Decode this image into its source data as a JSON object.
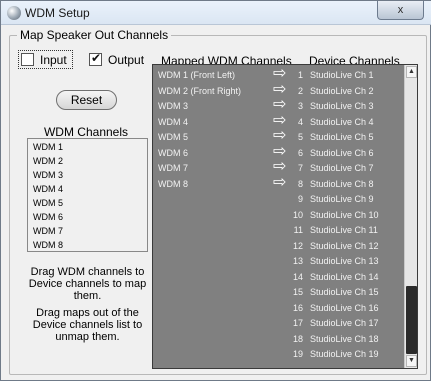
{
  "window": {
    "title": "WDM Setup",
    "close_glyph": "x"
  },
  "group": {
    "title": "Map Speaker Out Channels"
  },
  "checkboxes": {
    "input": {
      "label": "Input",
      "checked": false
    },
    "output": {
      "label": "Output",
      "checked": true
    }
  },
  "reset_label": "Reset",
  "wdm_channels": {
    "heading": "WDM Channels",
    "items": [
      "WDM 1",
      "WDM 2",
      "WDM 3",
      "WDM 4",
      "WDM 5",
      "WDM 6",
      "WDM 7",
      "WDM 8"
    ]
  },
  "help": {
    "drag_to_map": "Drag WDM channels to Device channels to map them.",
    "drag_to_unmap": "Drag maps out of the Device channels list to unmap them."
  },
  "headers": {
    "mapped": "Mapped WDM Channels",
    "device": "Device Channels"
  },
  "arrow_glyph": "⇨",
  "rows": [
    {
      "wdm": "WDM 1 (Front Left)",
      "num": "1",
      "device": "StudioLive Ch 1",
      "mapped": true
    },
    {
      "wdm": "WDM 2 (Front Right)",
      "num": "2",
      "device": "StudioLive Ch 2",
      "mapped": true
    },
    {
      "wdm": "WDM 3",
      "num": "3",
      "device": "StudioLive Ch 3",
      "mapped": true
    },
    {
      "wdm": "WDM 4",
      "num": "4",
      "device": "StudioLive Ch 4",
      "mapped": true
    },
    {
      "wdm": "WDM 5",
      "num": "5",
      "device": "StudioLive Ch 5",
      "mapped": true
    },
    {
      "wdm": "WDM 6",
      "num": "6",
      "device": "StudioLive Ch 6",
      "mapped": true
    },
    {
      "wdm": "WDM 7",
      "num": "7",
      "device": "StudioLive Ch 7",
      "mapped": true
    },
    {
      "wdm": "WDM 8",
      "num": "8",
      "device": "StudioLive Ch 8",
      "mapped": true
    },
    {
      "wdm": "",
      "num": "9",
      "device": "StudioLive Ch 9",
      "mapped": false
    },
    {
      "wdm": "",
      "num": "10",
      "device": "StudioLive Ch 10",
      "mapped": false
    },
    {
      "wdm": "",
      "num": "11",
      "device": "StudioLive Ch 11",
      "mapped": false
    },
    {
      "wdm": "",
      "num": "12",
      "device": "StudioLive Ch 12",
      "mapped": false
    },
    {
      "wdm": "",
      "num": "13",
      "device": "StudioLive Ch 13",
      "mapped": false
    },
    {
      "wdm": "",
      "num": "14",
      "device": "StudioLive Ch 14",
      "mapped": false
    },
    {
      "wdm": "",
      "num": "15",
      "device": "StudioLive Ch 15",
      "mapped": false
    },
    {
      "wdm": "",
      "num": "16",
      "device": "StudioLive Ch 16",
      "mapped": false
    },
    {
      "wdm": "",
      "num": "17",
      "device": "StudioLive Ch 17",
      "mapped": false
    },
    {
      "wdm": "",
      "num": "18",
      "device": "StudioLive Ch 18",
      "mapped": false
    },
    {
      "wdm": "",
      "num": "19",
      "device": "StudioLive Ch 19",
      "mapped": false
    }
  ],
  "scrollbar": {
    "up_glyph": "▲",
    "down_glyph": "▼"
  }
}
